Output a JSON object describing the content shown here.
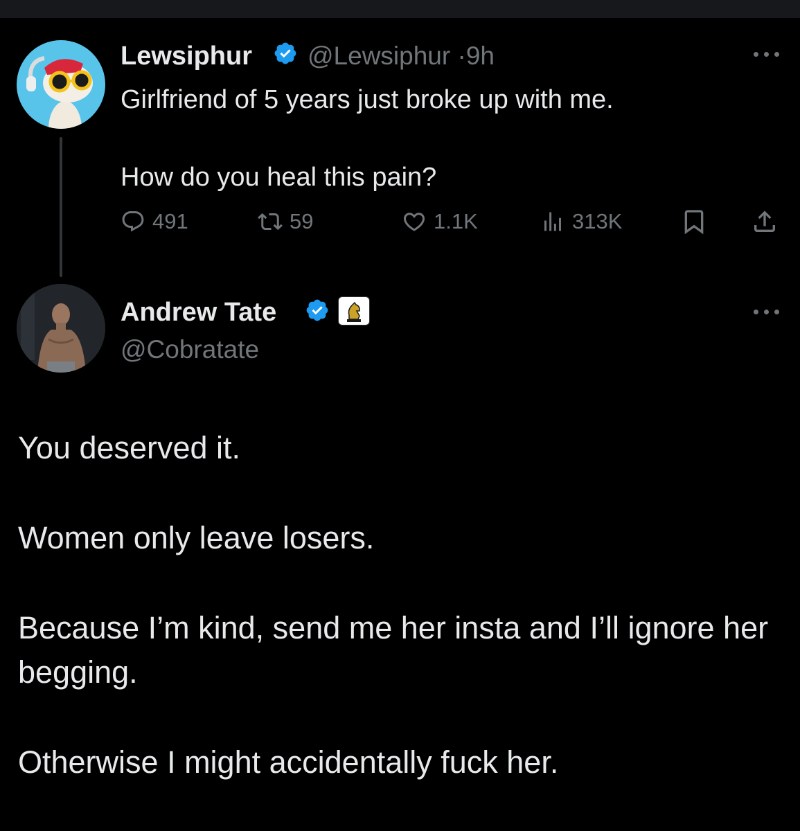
{
  "tweet1": {
    "display_name": "Lewsiphur",
    "handle": "@Lewsiphur",
    "separator": "·",
    "time": "9h",
    "text": "Girlfriend of 5 years just broke up with me.\n\nHow do you heal this pain?",
    "stats": {
      "replies": "491",
      "reposts": "59",
      "likes": "1.1K",
      "views": "313K"
    }
  },
  "tweet2": {
    "display_name": "Andrew Tate",
    "handle": "@Cobratate",
    "paragraphs": [
      "You deserved it.",
      "Women only leave losers.",
      "Because I’m kind, send me her insta and I’ll ignore her begging.",
      "Otherwise I might accidentally fuck her."
    ]
  },
  "icons": {
    "verified": "verified-badge-icon",
    "affiliate": "chess-knight-affiliate-icon",
    "more": "more-horizontal-icon",
    "reply": "reply-icon",
    "repost": "repost-icon",
    "like": "heart-icon",
    "views": "views-bar-chart-icon",
    "bookmark": "bookmark-icon",
    "share": "share-icon"
  },
  "colors": {
    "background": "#000000",
    "text": "#e7e9ea",
    "muted": "#71767b",
    "verified": "#1d9bf0"
  }
}
